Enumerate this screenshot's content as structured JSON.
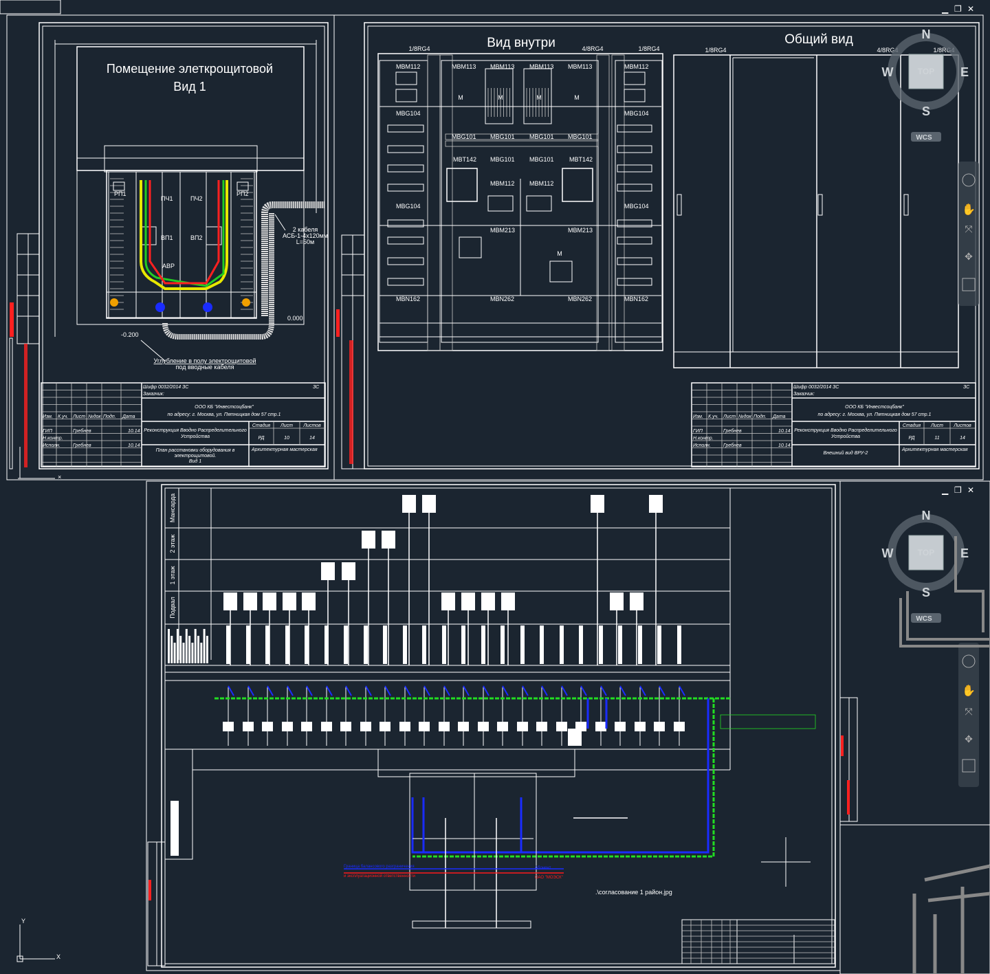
{
  "colors": {
    "background": "#1b2530",
    "lines": "#ffffff",
    "blue": "#1a2cff",
    "red": "#ff1a1a",
    "green": "#22dd22",
    "yellow": "#e8e800",
    "orange": "#f0a000"
  },
  "window_controls": {
    "minimize": "▁",
    "restore": "❐",
    "close": "✕"
  },
  "left_sheet": {
    "title_line1": "Помещение элеткрощитовой",
    "title_line2": "Вид 1",
    "labels": [
      "РП1",
      "ПЧ1",
      "ПЧ2",
      "РП2",
      "ВП1",
      "ВП2",
      "АВР"
    ],
    "cable_note": [
      "2 кабеля",
      "АСБ-1-4х120мм",
      "L=50м"
    ],
    "level_a": "0.000",
    "level_b": "-0.200",
    "recess_note": [
      "Углубление в полу электрощитовой",
      "под вводные кабеля"
    ]
  },
  "title_block_left": {
    "cipher": "Шифр 0032/2014 ЗС",
    "code": "ЗС",
    "customer": "Заказчик:",
    "org": "ООО КБ \"Инвестсоцбанк\"",
    "address": "по адресу: г. Москва, ул. Пятницкая дом 57 стр.1",
    "project": [
      "Реконструкция Вводно Распределительного",
      "Устройства"
    ],
    "stage_h": "Стадия",
    "sheet_h": "Лист",
    "sheets_h": "Листов",
    "stage": "РД",
    "sheet": "10",
    "sheets": "14",
    "drawing": [
      "План расстановки оборудования в",
      "электрощитовой.",
      "Вид 1"
    ],
    "firm": "Архитектурная мастерская",
    "headers": [
      "Изм.",
      "К.уч.",
      "Лист",
      "№док",
      "Подп.",
      "Дата"
    ],
    "rows": [
      [
        "ГИП",
        "Гребнев",
        "10.14"
      ],
      [
        "Н.контр.",
        "",
        ""
      ],
      [
        "Исполн.",
        "Гребнев",
        "10.14"
      ]
    ]
  },
  "title_block_right": {
    "cipher": "Шифр 0032/2014 ЗС",
    "code": "ЗС",
    "customer": "Заказчик:",
    "org": "ООО КБ \"Инвестсоцбанк\"",
    "address": "по адресу: г. Москва, ул. Пятницкая дом 57 стр.1",
    "project": [
      "Реконструкция Вводно Распределительного",
      "Устройства"
    ],
    "stage_h": "Стадия",
    "sheet_h": "Лист",
    "sheets_h": "Листов",
    "stage": "РД",
    "sheet": "11",
    "sheets": "14",
    "drawing": [
      "Внешний вид ВРУ-2"
    ],
    "firm": "Архитектурная мастерская",
    "headers": [
      "Изм.",
      "К.уч.",
      "Лист",
      "№док",
      "Подп.",
      "Дата"
    ],
    "rows": [
      [
        "ГИП",
        "Гребнев",
        "10.14"
      ],
      [
        "Н.контр.",
        "",
        ""
      ],
      [
        "Исполн.",
        "Гребнев",
        "10.14"
      ]
    ]
  },
  "right_sheet": {
    "inside_title": "Вид внутри",
    "general_title": "Общий вид",
    "inside_tags": [
      "1/8RG4",
      "4/8RG4",
      "1/8RG4"
    ],
    "general_tags": [
      "1/8RG4",
      "4/8RG4",
      "1/8RG4"
    ],
    "modules_left": [
      "MBM112",
      "MBG104",
      "MBG104",
      "MBN162"
    ],
    "modules_center_top": [
      "MBM113",
      "MBM113",
      "MBM113",
      "MBM113"
    ],
    "modules_center_mid": [
      "MBG101",
      "MBG101",
      "MBG101",
      "MBG101"
    ],
    "modules_center_mt": [
      "MBT142",
      "MBG101",
      "MBG101",
      "MBT142"
    ],
    "modules_center_m112": [
      "MBM112",
      "MBM112"
    ],
    "modules_center_m213": [
      "MBM213",
      "MBM213"
    ],
    "modules_center_n262": [
      "MBN262",
      "MBN262"
    ],
    "modules_right": [
      "MBM112",
      "MBG104",
      "MBG104",
      "MBN162"
    ],
    "m": "M"
  },
  "nav_cube": {
    "n": "N",
    "s": "S",
    "e": "E",
    "w": "W",
    "top": "TOP",
    "wcs": "WCS"
  },
  "schematic": {
    "floors": [
      "Мансарда",
      "2 этаж",
      "1 этаж",
      "Подвал"
    ],
    "boundary_note": [
      "Граница балансового разграничения",
      "и эксплуатационной ответственности"
    ],
    "subscriber": "Абонент",
    "utility": "ОАО \"МОЭСК\"",
    "xref_file": ".\\согласование 1 район.jpg"
  },
  "ucs": {
    "x": "X",
    "y": "Y"
  }
}
